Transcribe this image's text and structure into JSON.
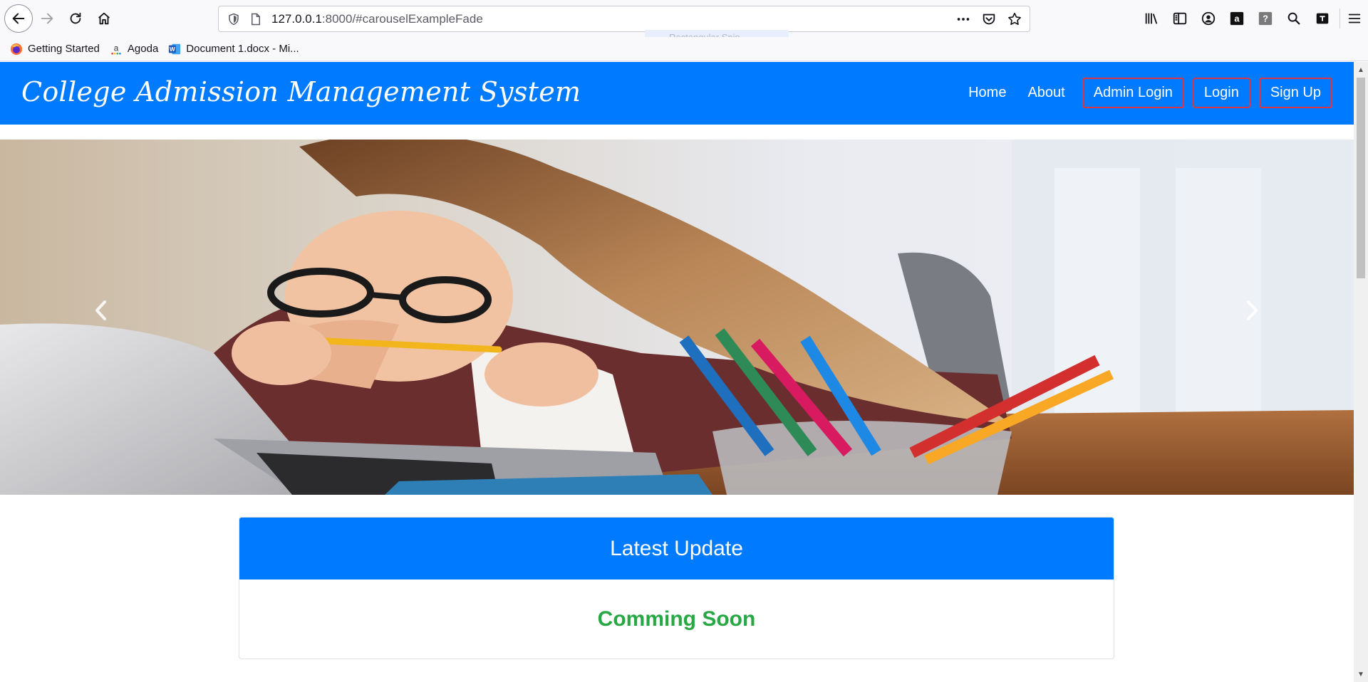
{
  "browser": {
    "url_host": "127.0.0.1",
    "url_rest": ":8000/#carouselExampleFade",
    "snip_hint": "Rectangular Snip",
    "bookmarks": [
      {
        "label": "Getting Started",
        "icon": "firefox-icon"
      },
      {
        "label": "Agoda",
        "icon": "agoda-icon"
      },
      {
        "label": "Document 1.docx - Mi...",
        "icon": "word-icon"
      }
    ]
  },
  "navbar": {
    "brand": "College Admission Management System",
    "links": {
      "home": "Home",
      "about": "About",
      "admin_login": "Admin Login",
      "login": "Login",
      "signup": "Sign Up"
    }
  },
  "carousel": {
    "prev_icon": "chevron-left-icon",
    "next_icon": "chevron-right-icon"
  },
  "update_card": {
    "title": "Latest Update",
    "body": "Comming Soon"
  },
  "colors": {
    "primary": "#007bff",
    "success": "#28a745",
    "danger_outline": "#dc3545"
  }
}
